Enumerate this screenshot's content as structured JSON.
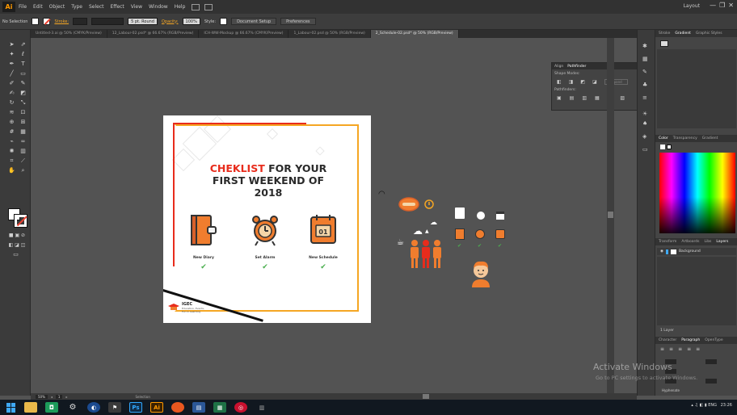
{
  "menubar": {
    "logo": "Ai",
    "items": [
      "File",
      "Edit",
      "Object",
      "Type",
      "Select",
      "Effect",
      "View",
      "Window",
      "Help"
    ],
    "workspace": "Layout",
    "window_buttons": [
      "—",
      "❐",
      "✕"
    ]
  },
  "control": {
    "selection": "No Selection",
    "stroke_label": "Stroke:",
    "brush": "5 pt. Round",
    "opacity_label": "Opacity:",
    "opacity_value": "100%",
    "style_label": "Style:",
    "doc_setup": "Document Setup",
    "preferences": "Preferences"
  },
  "tabs": [
    {
      "label": "Untitled-3.ai @ 50% (CMYK/Preview)",
      "active": false
    },
    {
      "label": "12_Labour-02.psd* @ 66.67% (RGB/Preview)",
      "active": false
    },
    {
      "label": "ICH-WW-Mockup @ 66.67% (CMYK/Preview)",
      "active": false
    },
    {
      "label": "1_Labour-02.psd @ 50% (RGB/Preview)",
      "active": false
    },
    {
      "label": "2_Schedule-02.psd* @ 50% (RGB/Preview)",
      "active": true
    }
  ],
  "artboard": {
    "title_red": "CHEKLIST",
    "title_rest_1": " FOR YOUR",
    "title_line_2": "FIRST WEEKEND  OF",
    "title_line_3": "2018",
    "cards": [
      {
        "label": "New Diary",
        "check": "✔"
      },
      {
        "label": "Set Alarm",
        "check": "✔"
      },
      {
        "label": "New Schedule",
        "check": "✔"
      }
    ],
    "calendar_number": "01",
    "logo_text": "IGEC",
    "logo_sub_1": "Education, Events,",
    "logo_sub_2": "Fun in Learning"
  },
  "float_panel": {
    "tabs": [
      "Align",
      "Pathfinder"
    ],
    "shape_modes": "Shape Modes:",
    "pathfinders": "Pathfinders:",
    "expand": "Expand"
  },
  "right_panel": {
    "top_tabs": [
      "Stroke",
      "Gradient",
      "Graphic Styles"
    ],
    "color_tabs": [
      "Color",
      "Transparency",
      "Gradient"
    ],
    "layer_tabs": [
      "Transform",
      "Artboards",
      "Libs",
      "Layers"
    ],
    "layer_name": "Background",
    "char_tabs": [
      "Character",
      "Paragraph",
      "OpenType"
    ],
    "layer_count": "1 Layer",
    "hyphenate": "Hyphenate"
  },
  "statusbar": {
    "zoom": "50%",
    "page": "1",
    "tool": "Selection"
  },
  "watermark": {
    "line1": "Activate Windows",
    "line2": "Go to PC settings to activate Windows."
  },
  "taskbar": {
    "ps": "Ps",
    "ai": "Ai",
    "time": "23:26",
    "tray_label": "ENG"
  },
  "colors": {
    "accent_red": "#e82c1c",
    "accent_orange": "#f5a623",
    "icon_orange": "#f07d2e",
    "check_green": "#4caf50",
    "ui_dark": "#323232",
    "ui_canvas": "#535353"
  }
}
